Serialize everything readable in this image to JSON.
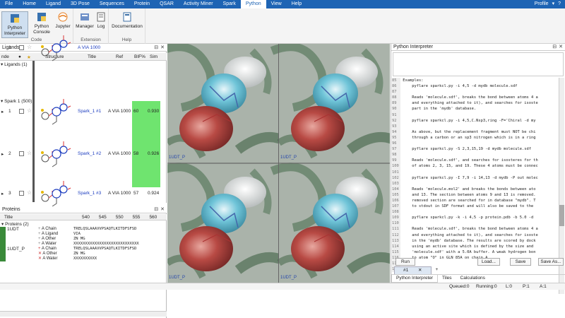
{
  "menu": [
    "File",
    "Home",
    "Ligand",
    "3D Pose",
    "Sequences",
    "Protein",
    "QSAR",
    "Activity Miner",
    "Spark",
    "Python",
    "View",
    "Help"
  ],
  "menu_active": "Python",
  "profile": "Profile",
  "ribbon": {
    "code_group": "Code",
    "extension_group": "Extension",
    "help_group": "Help",
    "buttons": {
      "python_interpreter": "Python Interpreter",
      "python_console": "Python Console",
      "jupyter": "Jupyter",
      "manager": "Manager",
      "log": "Log",
      "documentation": "Documentation"
    }
  },
  "ligands": {
    "title": "Ligands",
    "columns": [
      "nde",
      "Structure",
      "Title",
      "Ref",
      "BIF%",
      "Sim"
    ],
    "group1": "Ligands (1)",
    "group2": "Spark 1 (500)",
    "rows": [
      {
        "index": "1",
        "title": "A VIA 1000",
        "ref": "",
        "bif": "",
        "sim": ""
      },
      {
        "index": "1",
        "title": "Spark_1 #1",
        "ref": "A VIA 1000",
        "bif": "60",
        "sim": "0.930"
      },
      {
        "index": "2",
        "title": "Spark_1 #2",
        "ref": "A VIA 1000",
        "bif": "58",
        "sim": "0.926"
      },
      {
        "index": "3",
        "title": "Spark_1 #3",
        "ref": "A VIA 1000",
        "bif": "57",
        "sim": "0.924"
      }
    ]
  },
  "proteins": {
    "title": "Proteins",
    "col_title": "Title",
    "ruler": [
      "540",
      "545",
      "550",
      "555",
      "560"
    ],
    "group": "Proteins (2)",
    "items": [
      {
        "name": "1UDT",
        "chains": [
          {
            "label": "A Chain",
            "seq": "TRELQSLAAAVVPSAQTLKITDFSFSD"
          },
          {
            "label": "A Ligand",
            "seq": "VIA"
          },
          {
            "label": "A Other",
            "seq": "ZN MG"
          },
          {
            "label": "A Water",
            "seq": "XXXXXXXXXXXXXXXXXXXXXXXXXXXX"
          }
        ]
      },
      {
        "name": "1UDT_P",
        "chains": [
          {
            "label": "A Chain",
            "seq": "TRELQSLAAAVVPSAQTLKITDFSFSD"
          },
          {
            "label": "A Other",
            "seq": "ZN MG"
          },
          {
            "label": "A Water",
            "seq": "XXXXXXXXXX"
          }
        ]
      }
    ]
  },
  "viewer": {
    "labels": [
      "1UDT_P",
      "1UDT_P",
      "1UDT_P",
      "1UDT_P"
    ]
  },
  "interpreter": {
    "title": "Python Interpreter",
    "lines": [
      {
        "n": "85",
        "t": "Examples:"
      },
      {
        "n": "86",
        "t": "    pyflare sparkcl.py -i 4,5 -d mydb molecule.sdf"
      },
      {
        "n": "87",
        "t": ""
      },
      {
        "n": "88",
        "t": "    Reads 'molecule.sdf', breaks the bond between atoms 4 a"
      },
      {
        "n": "89",
        "t": "    and everything attached to it), and searches for isoste"
      },
      {
        "n": "90",
        "t": "    part in the 'mydb' database."
      },
      {
        "n": "91",
        "t": ""
      },
      {
        "n": "92",
        "t": "    pyflare sparkcl.py -i 4,5,C.Nsp3,ring -F='Chiral -d my"
      },
      {
        "n": "93",
        "t": ""
      },
      {
        "n": "94",
        "t": "    As above, but the replacement fragment must NOT be chi"
      },
      {
        "n": "95",
        "t": "    through a carbon or an sp3 nitrogen which is in a ring"
      },
      {
        "n": "96",
        "t": ""
      },
      {
        "n": "97",
        "t": "    pyflare sparkcl.py -S 2,3,15,19 -d mydb molecule.sdf"
      },
      {
        "n": "98",
        "t": ""
      },
      {
        "n": "99",
        "t": "    Reads 'molecule.sdf', and searches for isosteres for th"
      },
      {
        "n": "100",
        "t": "    of atoms 2, 3, 15, and 19. These 4 atoms must be connec"
      },
      {
        "n": "101",
        "t": ""
      },
      {
        "n": "102",
        "t": "    pyflare sparkcl.py -I 7,9 -i 14,13 -d mydb -P out molec"
      },
      {
        "n": "103",
        "t": ""
      },
      {
        "n": "104",
        "t": "    Reads 'molecule.mol2' and breaks the bonds between ato"
      },
      {
        "n": "105",
        "t": "    and 13. The section between atoms 9 and 13 is removed."
      },
      {
        "n": "106",
        "t": "    removed section are searched for in database \"mydb\". T"
      },
      {
        "n": "107",
        "t": "    to stdout in SDF format and will also be saved to the"
      },
      {
        "n": "108",
        "t": ""
      },
      {
        "n": "109",
        "t": "    pyflare sparkcl.py -k -i 4,5 -p protein.pdb -b 5.0 -d"
      },
      {
        "n": "110",
        "t": ""
      },
      {
        "n": "111",
        "t": "    Reads 'molecule.sdf', breaks the bond between atoms 4 a"
      },
      {
        "n": "112",
        "t": "    and everything attached to it), and searches for isoste"
      },
      {
        "n": "113",
        "t": "    in the 'mydb' database. The results are scored by dock"
      },
      {
        "n": "114",
        "t": "    using an active site which is defined by the size and"
      },
      {
        "n": "115",
        "t": "    'molecule.sdf' with a 5.0A buffer. A weak hydrogen bon"
      },
      {
        "n": "116",
        "t": "    to atom \"O\" in GLN 85A on chain A."
      },
      {
        "n": "117",
        "t": ""
      },
      {
        "n": "118",
        "t": ""
      }
    ],
    "run": "Run",
    "load": "Load...",
    "save": "Save",
    "save_as": "Save As...",
    "tab_label": "#1",
    "tab_add": "+",
    "bottom_tabs": [
      "Python Interpreter",
      "Tiles",
      "Calculations"
    ]
  },
  "status": {
    "queued": "Queued:0",
    "running": "Running:0",
    "l": "L:0",
    "p": "P:1",
    "a": "A:1"
  }
}
